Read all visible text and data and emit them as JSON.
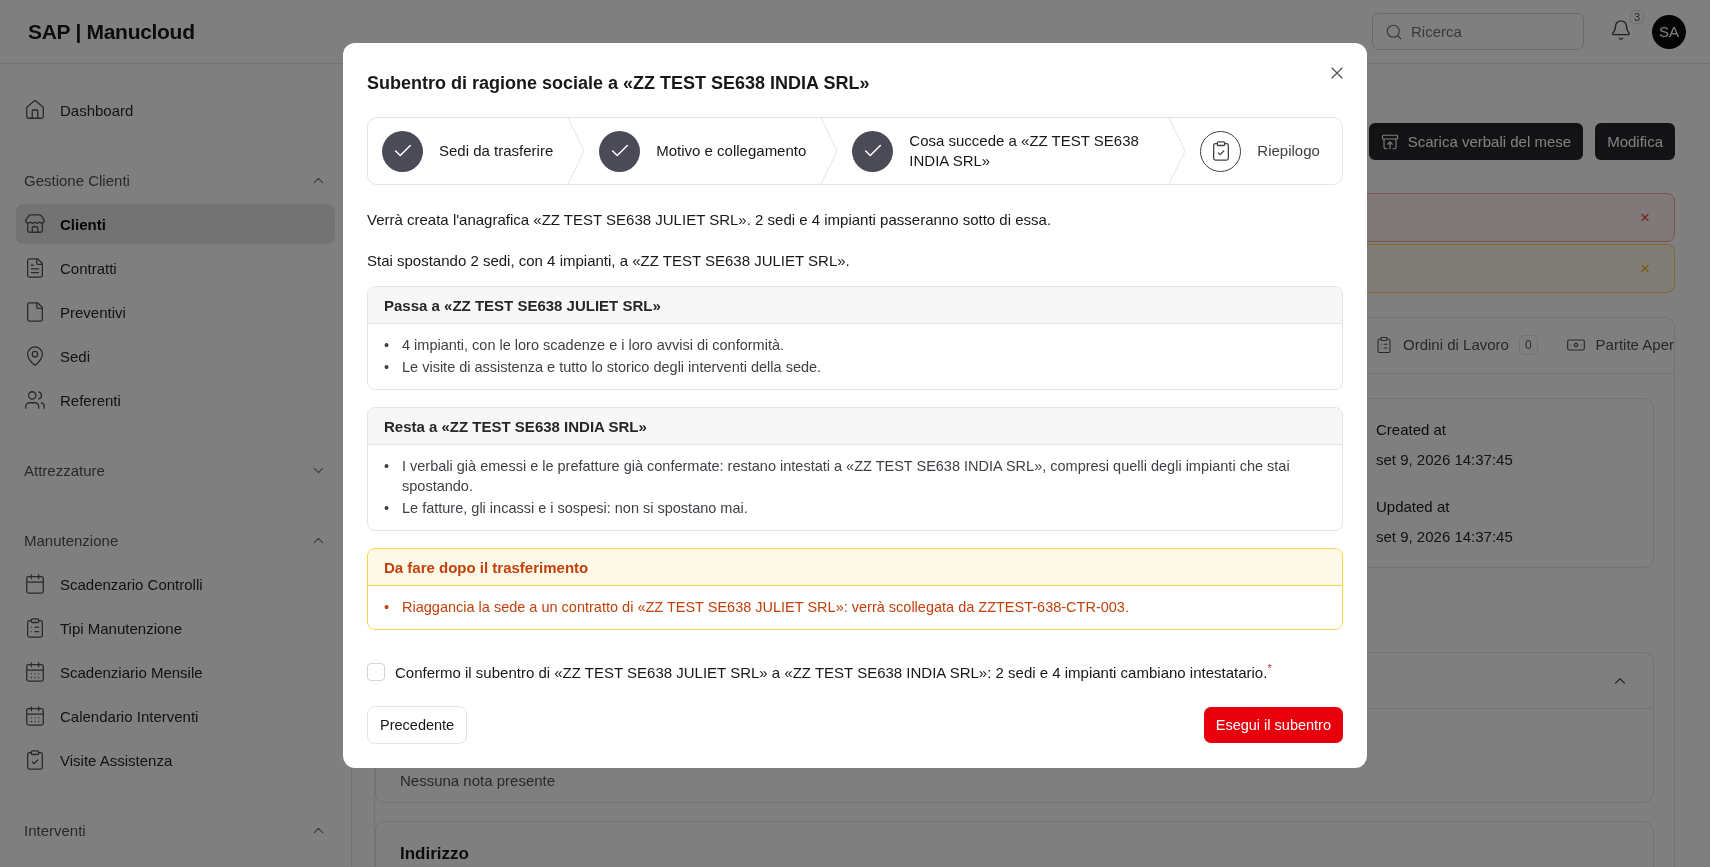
{
  "header": {
    "logo": "SAP | Manucloud",
    "search": {
      "placeholder": "Ricerca"
    },
    "notifications": "3",
    "avatar": "SA"
  },
  "sidebar": [
    {
      "kind": "link",
      "label": "Dashboard",
      "selected": false
    },
    {
      "kind": "group",
      "label": "Gestione Clienti",
      "expanded": true,
      "children": [
        {
          "label": "Clienti",
          "selected": true
        },
        {
          "label": "Contratti",
          "selected": false
        },
        {
          "label": "Preventivi",
          "selected": false
        },
        {
          "label": "Sedi",
          "selected": false
        },
        {
          "label": "Referenti",
          "selected": false
        }
      ]
    },
    {
      "kind": "group",
      "label": "Attrezzature",
      "expanded": false
    },
    {
      "kind": "group",
      "label": "Manutenzione",
      "expanded": true,
      "children": [
        {
          "label": "Scadenzario Controlli",
          "selected": false
        },
        {
          "label": "Tipi Manutenzione",
          "selected": false
        },
        {
          "label": "Scadenziario Mensile",
          "selected": false
        },
        {
          "label": "Calendario Interventi",
          "selected": false
        },
        {
          "label": "Visite Assistenza",
          "selected": false
        }
      ]
    },
    {
      "kind": "group",
      "label": "Interventi",
      "expanded": true
    }
  ],
  "page": {
    "actions": [
      {
        "label": "Scarica verbali del mese",
        "kind": "download"
      },
      {
        "label": "Modifica",
        "kind": "plain"
      }
    ],
    "alerts": [
      {
        "kind": "error",
        "close": "×"
      },
      {
        "kind": "warning",
        "close": "×"
      }
    ],
    "tabs": [
      {
        "label": "Ordini di Lavoro",
        "count": "0",
        "selected": false
      },
      {
        "label": "Partite Aper",
        "selected": false
      }
    ],
    "meta": [
      {
        "label": "Created at",
        "value": "set 9, 2026 14:37:45"
      },
      {
        "label": "Updated at",
        "value": "set 9, 2026 14:37:45"
      }
    ],
    "notes": {
      "expanded": true,
      "empty": "Nessuna nota presente"
    },
    "address": {
      "title": "Indirizzo"
    }
  },
  "modal": {
    "title": "Subentro di ragione sociale a «ZZ TEST SE638 INDIA SRL»",
    "steps": [
      {
        "label": "Sedi da trasferire",
        "done": true
      },
      {
        "label": "Motivo e collegamento",
        "done": true
      },
      {
        "label": "Cosa succede a «ZZ TEST SE638 INDIA SRL»",
        "done": true
      },
      {
        "label": "Riepilogo",
        "done": false
      }
    ],
    "intro": [
      "Verrà creata l'anagrafica «ZZ TEST SE638 JULIET SRL». 2 sedi e 4 impianti passeranno sotto di essa.",
      "Stai spostando 2 sedi, con 4 impianti, a «ZZ TEST SE638 JULIET SRL»."
    ],
    "sections": [
      {
        "kind": "neutral",
        "title": "Passa a «ZZ TEST SE638 JULIET SRL»",
        "marker": "•",
        "items": [
          "4 impianti, con le loro scadenze e i loro avvisi di conformità.",
          "Le visite di assistenza e tutto lo storico degli interventi della sede."
        ]
      },
      {
        "kind": "neutral",
        "title": "Resta a «ZZ TEST SE638 INDIA SRL»",
        "marker": "•",
        "items": [
          "I verbali già emessi e le prefatture già confermate: restano intestati a «ZZ TEST SE638 INDIA SRL», compresi quelli degli impianti che stai spostando.",
          "Le fatture, gli incassi e i sospesi: non si spostano mai."
        ]
      },
      {
        "kind": "warning",
        "title": "Da fare dopo il trasferimento",
        "marker": "•",
        "items": [
          "Riaggancia la sede a un contratto di «ZZ TEST SE638 JULIET SRL»: verrà scollegata da ZZTEST-638-CTR-003."
        ]
      }
    ],
    "confirm": {
      "label": "Confermo il subentro di «ZZ TEST SE638 JULIET SRL» a «ZZ TEST SE638 INDIA SRL»: 2 sedi e 4 impianti cambiano intestatario.",
      "required_mark": "*",
      "checked": false
    },
    "back": "Precedente",
    "submit": "Esegui il subentro"
  }
}
